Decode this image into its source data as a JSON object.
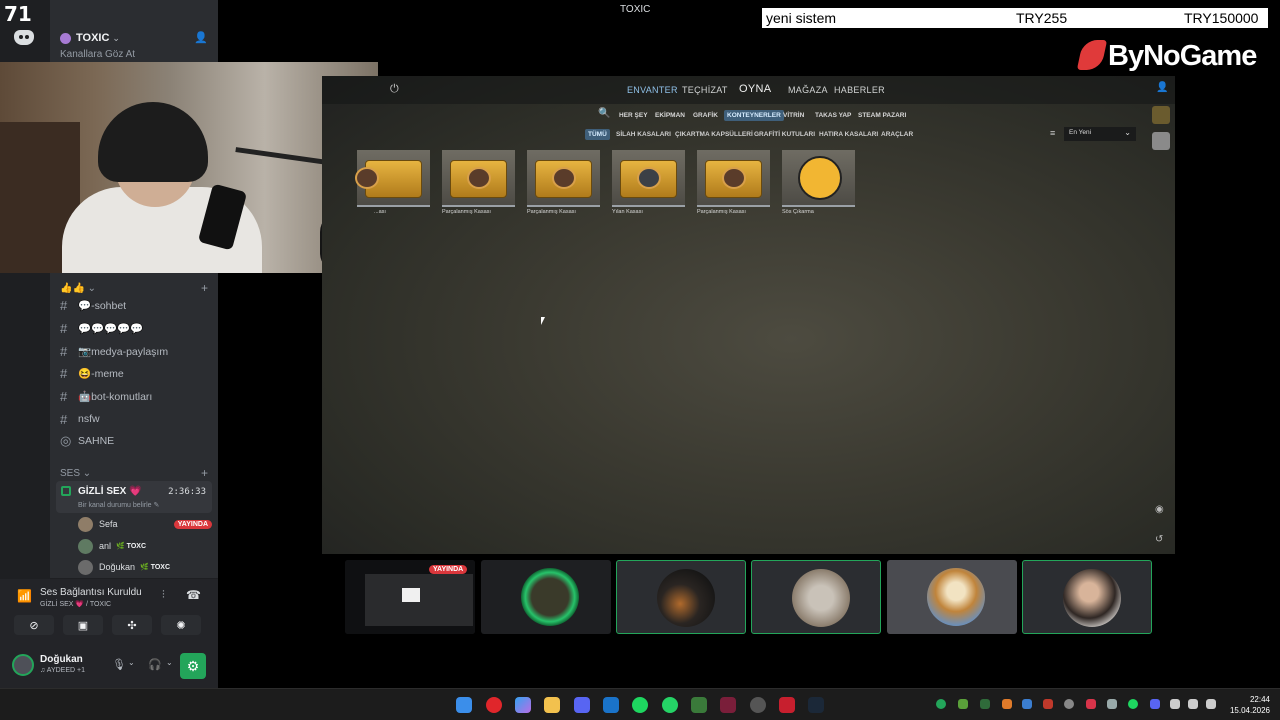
{
  "overlay": {
    "rail_counter": "71",
    "window_title": "TOXIC",
    "ticker": {
      "label": "yeni sistem",
      "price": "TRY255",
      "goal": "TRY150000"
    },
    "brand": "ByNoGame"
  },
  "discord": {
    "server_name": "TOXIC",
    "browse_channels": "Kanallara Göz At",
    "category_emoji": "👍👍 ⌄",
    "text_channels": [
      {
        "label": "💬-sohbet"
      },
      {
        "label": "💬💬💬💬💬"
      },
      {
        "label": "📷medya-paylaşım"
      },
      {
        "label": "😆-meme"
      },
      {
        "label": "🤖bot-komutları"
      },
      {
        "label": "nsfw"
      }
    ],
    "stage_channel": "SAHNE",
    "voice_category": "SES ⌄",
    "voice_channel": {
      "name": "GİZLİ SEX 💗",
      "time": "2:36:33",
      "status": "Bir kanal durumu belirle ✎"
    },
    "voice_users": [
      {
        "name": "Sefa",
        "badge": "YAYINDA",
        "tag": ""
      },
      {
        "name": "anl",
        "badge": "",
        "tag": "🌿 TOXC"
      },
      {
        "name": "Doğukan",
        "badge": "",
        "tag": "🌿 TOXC"
      }
    ],
    "voice_panel": {
      "title": "Ses Bağlantısı Kuruldu",
      "subtitle": "GİZLİ SEX 💗 / TOXIC"
    },
    "user": {
      "name": "Doğukan",
      "status": "♫ AYDEED +1"
    }
  },
  "game": {
    "nav": {
      "inventory": "ENVANTER",
      "loadout": "TEÇHİZAT",
      "play": "OYNA",
      "store": "MAĞAZA",
      "news": "HABERLER"
    },
    "subnav": [
      "HER ŞEY",
      "EKİPMAN",
      "GRAFİK",
      "KONTEYNERLER",
      "VİTRİN",
      "TAKAS YAP",
      "STEAM PAZARI"
    ],
    "filters": [
      "TÜMÜ",
      "SİLAH KASALARI",
      "ÇIKARTMA KAPSÜLLERİ",
      "GRAFİTİ KUTULARI",
      "HATIRA KASALARI",
      "ARAÇLAR"
    ],
    "sort": "En Yeni",
    "items": [
      {
        "name": "...ası",
        "kind": "case"
      },
      {
        "name": "Parçalanmış Kasası",
        "kind": "case"
      },
      {
        "name": "Parçalanmış Kasası",
        "kind": "case"
      },
      {
        "name": "Yılan Kasası",
        "kind": "case"
      },
      {
        "name": "Parçalanmış Kasası",
        "kind": "case"
      },
      {
        "name": "Sös Çıkarma",
        "kind": "tool"
      }
    ]
  },
  "stream_tiles": {
    "live_label": "YAYINDA"
  },
  "taskbar": {
    "time": "22:44",
    "date": "15.04.2026"
  }
}
